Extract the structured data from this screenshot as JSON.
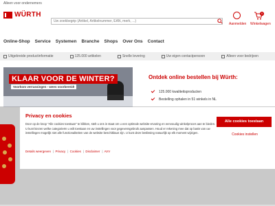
{
  "topbar": {
    "text": "Alleen voor ondernemers"
  },
  "header": {
    "logo_text": "WÜRTH",
    "search_placeholder": "Uw zoekbegrip (Artikel, Artikelnummer, EAN, merk, ...)",
    "account_label": "Aanmelden",
    "cart_label": "Winkelwagen",
    "cart_count": "0"
  },
  "nav": {
    "items": [
      "Online-Shop",
      "Service",
      "Systemen",
      "Branche",
      "Shops",
      "Over Ons",
      "Contact"
    ]
  },
  "usp": {
    "items": [
      "Uitgebreide productinformatie",
      "125.000 artikelen",
      "Snelle levering",
      "Uw eigen contactpersoon",
      "Alleen voor bedrijven"
    ]
  },
  "banner": {
    "headline": "KLAAR VOOR DE WINTER?",
    "subline": "Voorkom verrassingen - wees voorbereid!"
  },
  "promo": {
    "title": "Ontdek online bestellen bij Würth:",
    "items": [
      "125.000 kwaliteitsproducten",
      "Bestelling ophalen in 51 winkels in NL"
    ]
  },
  "cookie": {
    "title": "Privacy en cookies",
    "text": "Door op de knop \"Alle cookies toestaan\" te klikken, stelt u ons in staat om u een optimale website-ervaring en eenvoudig winkelproces aan te bieden. U kunt kiezen welke categorieën u wilt toestaan en uw instellingen voor gegevensgebruik aanpassen. Houd er rekening mee dat op basis van uw instellingen mogelijk niet alle functionaliteiten van de website beschikbaar zijn. U kunt deze beslissing natuurlijk op elk moment wijzigen.",
    "links": [
      "Details weergeven",
      "Privacy",
      "Cookies",
      "Disclaimer",
      "AVV"
    ],
    "accept_label": "Alle cookies toestaan",
    "settings_label": "Cookies instellen"
  },
  "colors": {
    "brand": "#cc0000"
  }
}
